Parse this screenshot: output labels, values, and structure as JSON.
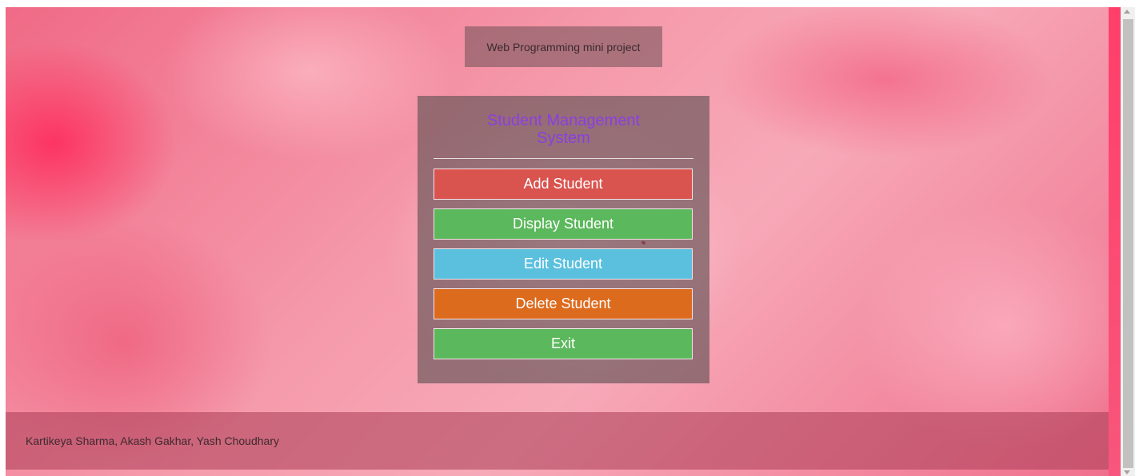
{
  "header": {
    "project_title": "Web Programming mini project"
  },
  "panel": {
    "title": "Student Management System",
    "buttons": [
      {
        "label": "Add Student",
        "color": "#d9534f"
      },
      {
        "label": "Display Student",
        "color": "#5cb85c"
      },
      {
        "label": "Edit Student",
        "color": "#5bc0de"
      },
      {
        "label": "Delete Student",
        "color": "#dd6b1d"
      },
      {
        "label": "Exit",
        "color": "#5cb85c"
      }
    ]
  },
  "footer": {
    "authors": "Kartikeya Sharma, Akash Gakhar, Yash Choudhary"
  },
  "colors": {
    "title_text": "#8a3fe0",
    "background_accent": "#f06a86"
  }
}
